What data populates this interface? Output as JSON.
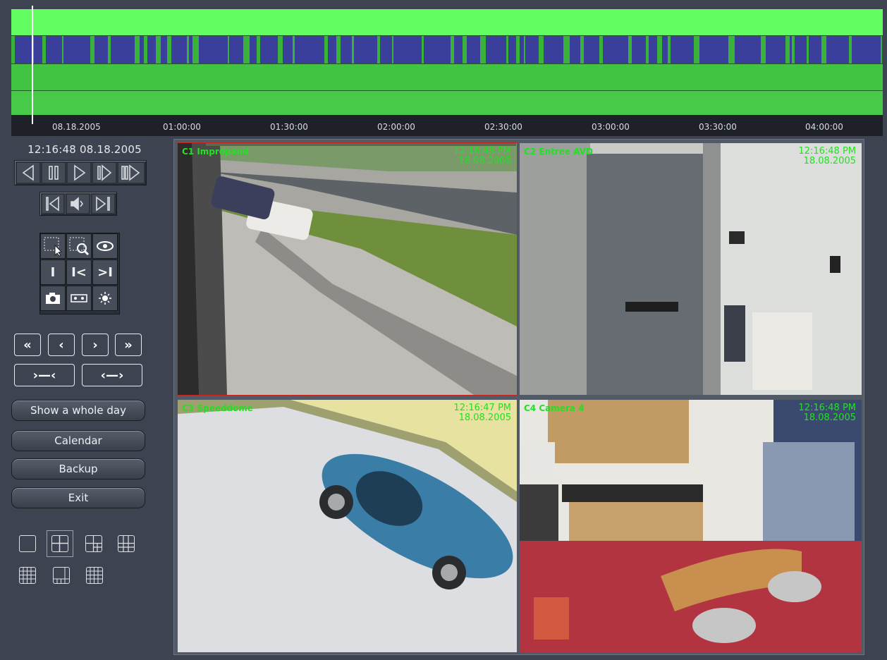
{
  "timeline": {
    "ticks": [
      "08.18.2005",
      "01:00:00",
      "01:30:00",
      "02:00:00",
      "02:30:00",
      "03:00:00",
      "03:30:00",
      "04:00:00"
    ],
    "colors": {
      "bright": "#61fd61",
      "recorded": "#393f9a",
      "green": "#40c442"
    }
  },
  "clock": "12:16:48 08.18.2005",
  "playback": {
    "row1": [
      "rewind-icon",
      "pause-icon",
      "play-icon",
      "step-forward-icon",
      "fast-forward-icon"
    ],
    "row2": [
      "skip-start-icon",
      "audio-icon",
      "skip-end-icon"
    ]
  },
  "tools": {
    "row1": [
      "select-region-icon",
      "zoom-region-icon",
      "eye-icon"
    ],
    "row2": [
      "cursor-i-icon",
      "mark-in-icon",
      "mark-out-icon"
    ],
    "row3": [
      "snapshot-icon",
      "tape-icon",
      "brightness-icon"
    ],
    "glyphs": {
      "cursor": "I",
      "mark_in": "I<",
      "mark_out": ">I"
    }
  },
  "nav": {
    "first": "«",
    "prev": "‹",
    "next": "›",
    "last": "»",
    "shrink": "›—‹",
    "expand": "‹—›"
  },
  "buttons": {
    "whole_day": "Show a whole day",
    "calendar": "Calendar",
    "backup": "Backup",
    "exit": "Exit"
  },
  "layouts": [
    "layout-1x1-icon",
    "layout-2x2-icon",
    "layout-3x3-icon",
    "layout-4x4-icon",
    "layout-grid-a-icon",
    "layout-grid-b-icon",
    "layout-grid-c-icon"
  ],
  "cameras": [
    {
      "label": "C1 Impropand",
      "time": "12:16:48 PM",
      "date": "18.08.2005"
    },
    {
      "label": "C2 Entree AVD",
      "time": "12:16:48 PM",
      "date": "18.08.2005"
    },
    {
      "label": "C3 Speeddome",
      "time": "12:16:47 PM",
      "date": "18.08.2005"
    },
    {
      "label": "C4 Camera 4",
      "time": "12:16:48 PM",
      "date": "18.08.2005"
    }
  ]
}
